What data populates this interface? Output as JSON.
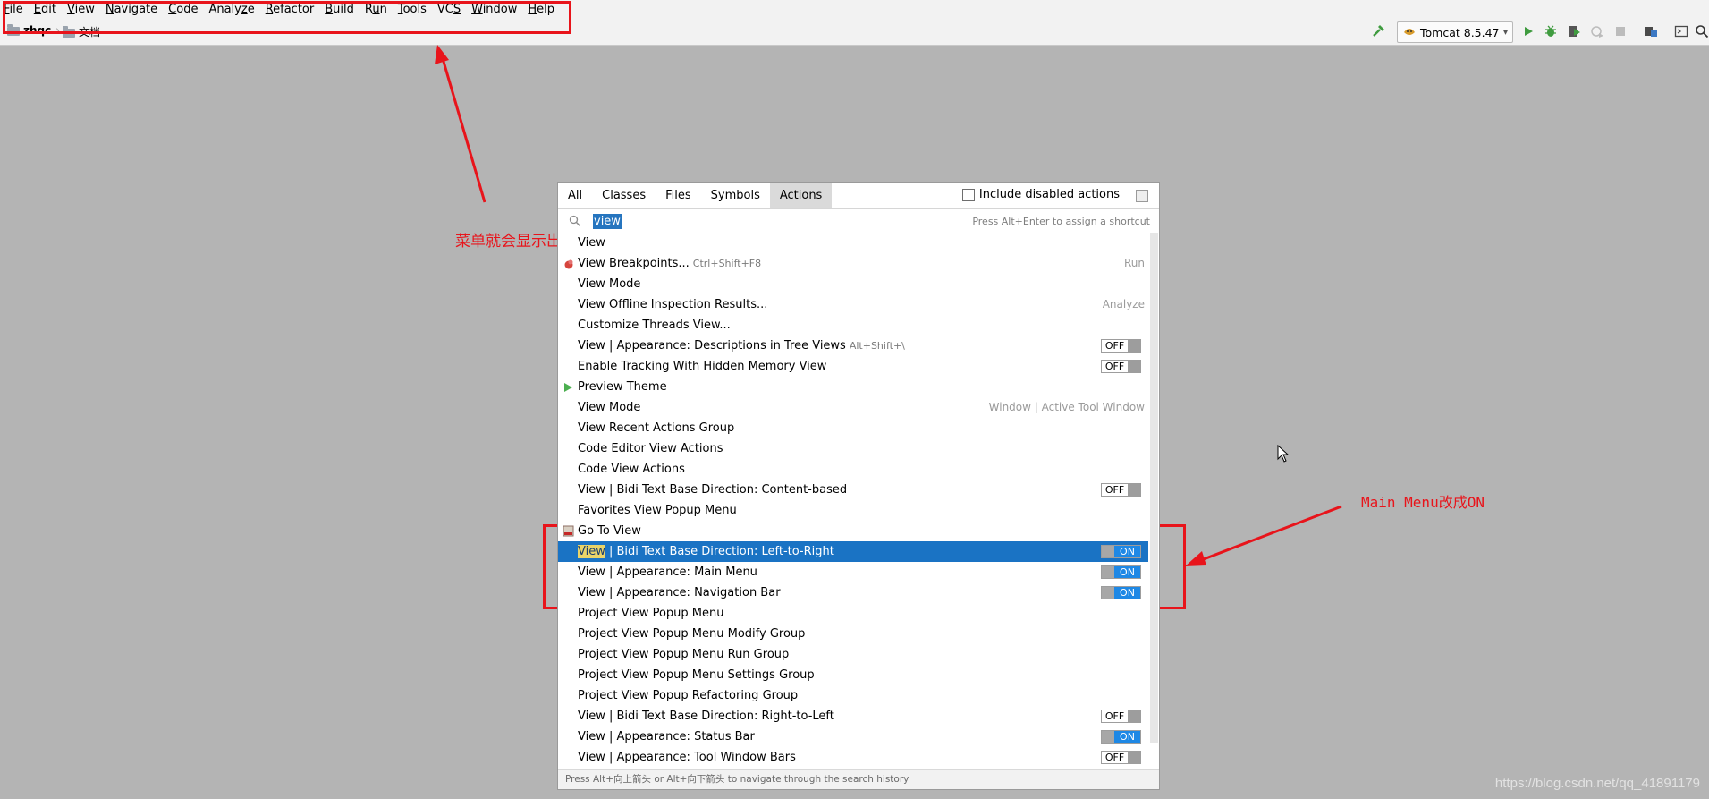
{
  "menubar": {
    "items": [
      {
        "mn": "F",
        "rest": "ile"
      },
      {
        "mn": "E",
        "rest": "dit"
      },
      {
        "mn": "V",
        "rest": "iew"
      },
      {
        "mn": "N",
        "rest": "avigate"
      },
      {
        "mn": "C",
        "rest": "ode"
      },
      {
        "pre": "Analy",
        "mn": "z",
        "rest": "e"
      },
      {
        "mn": "R",
        "rest": "efactor"
      },
      {
        "mn": "B",
        "rest": "uild"
      },
      {
        "pre": "R",
        "mn": "u",
        "rest": "n"
      },
      {
        "mn": "T",
        "rest": "ools"
      },
      {
        "pre": "VC",
        "mn": "S",
        "rest": ""
      },
      {
        "mn": "W",
        "rest": "indow"
      },
      {
        "mn": "H",
        "rest": "elp"
      }
    ]
  },
  "navbar": {
    "project": "zhqc",
    "folder": "文档",
    "run_config": "Tomcat 8.5.47"
  },
  "annotations": {
    "menu_note": "菜单就会显示出来了",
    "toggle_note": "Main Menu改成ON"
  },
  "popup": {
    "tabs": [
      "All",
      "Classes",
      "Files",
      "Symbols",
      "Actions"
    ],
    "active_tab": "Actions",
    "include_disabled": "Include disabled actions",
    "search_query": "view",
    "search_hint": "Press Alt+Enter to assign a shortcut",
    "results": [
      {
        "label": "View",
        "shortcut": "",
        "group": "",
        "toggle": "",
        "icon": ""
      },
      {
        "label": "View Breakpoints...",
        "shortcut": "Ctrl+Shift+F8",
        "group": "Run",
        "toggle": "",
        "icon": "breakpoint-icon"
      },
      {
        "label": "View Mode",
        "shortcut": "",
        "group": "",
        "toggle": "",
        "icon": ""
      },
      {
        "label": "View Offline Inspection Results...",
        "shortcut": "",
        "group": "Analyze",
        "toggle": "",
        "icon": ""
      },
      {
        "label": "Customize Threads View...",
        "shortcut": "",
        "group": "",
        "toggle": "",
        "icon": ""
      },
      {
        "label": "View | Appearance: Descriptions in Tree Views",
        "shortcut": "Alt+Shift+\\",
        "group": "",
        "toggle": "OFF",
        "icon": ""
      },
      {
        "label": "Enable Tracking With Hidden Memory View",
        "shortcut": "",
        "group": "",
        "toggle": "OFF",
        "icon": ""
      },
      {
        "label": "Preview Theme",
        "shortcut": "",
        "group": "",
        "toggle": "",
        "icon": "play-icon"
      },
      {
        "label": "View Mode",
        "shortcut": "",
        "group": "Window | Active Tool Window",
        "toggle": "",
        "icon": ""
      },
      {
        "label": "View Recent Actions Group",
        "shortcut": "",
        "group": "",
        "toggle": "",
        "icon": ""
      },
      {
        "label": "Code Editor View Actions",
        "shortcut": "",
        "group": "",
        "toggle": "",
        "icon": ""
      },
      {
        "label": "Code View Actions",
        "shortcut": "",
        "group": "",
        "toggle": "",
        "icon": ""
      },
      {
        "label": "View | Bidi Text Base Direction: Content-based",
        "shortcut": "",
        "group": "",
        "toggle": "OFF",
        "icon": ""
      },
      {
        "label": "Favorites View Popup Menu",
        "shortcut": "",
        "group": "",
        "toggle": "",
        "icon": ""
      },
      {
        "label": "Go To View",
        "shortcut": "",
        "group": "",
        "toggle": "",
        "icon": "gotoview-icon"
      },
      {
        "label_hl": "View",
        "label": " | Bidi Text Base Direction: Left-to-Right",
        "shortcut": "",
        "group": "",
        "toggle": "ON",
        "icon": "",
        "selected": true
      },
      {
        "label": "View | Appearance: Main Menu",
        "shortcut": "",
        "group": "",
        "toggle": "ON",
        "icon": ""
      },
      {
        "label": "View | Appearance: Navigation Bar",
        "shortcut": "",
        "group": "",
        "toggle": "ON",
        "icon": ""
      },
      {
        "label": "Project View Popup Menu",
        "shortcut": "",
        "group": "",
        "toggle": "",
        "icon": ""
      },
      {
        "label": "Project View Popup Menu Modify Group",
        "shortcut": "",
        "group": "",
        "toggle": "",
        "icon": ""
      },
      {
        "label": "Project View Popup Menu Run Group",
        "shortcut": "",
        "group": "",
        "toggle": "",
        "icon": ""
      },
      {
        "label": "Project View Popup Menu Settings Group",
        "shortcut": "",
        "group": "",
        "toggle": "",
        "icon": ""
      },
      {
        "label": "Project View Popup Refactoring Group",
        "shortcut": "",
        "group": "",
        "toggle": "",
        "icon": ""
      },
      {
        "label": "View | Bidi Text Base Direction: Right-to-Left",
        "shortcut": "",
        "group": "",
        "toggle": "OFF",
        "icon": ""
      },
      {
        "label": "View | Appearance: Status Bar",
        "shortcut": "",
        "group": "",
        "toggle": "ON",
        "icon": ""
      },
      {
        "label": "View | Appearance: Tool Window Bars",
        "shortcut": "",
        "group": "",
        "toggle": "OFF",
        "icon": ""
      }
    ],
    "footer": "Press Alt+向上箭头 or Alt+向下箭头 to navigate through the search history"
  },
  "watermark": "https://blog.csdn.net/qq_41891179",
  "colors": {
    "selection": "#1a73c4",
    "toggle_on": "#1e88e5",
    "annotation": "#e8141b",
    "background": "#b4b4b4"
  }
}
